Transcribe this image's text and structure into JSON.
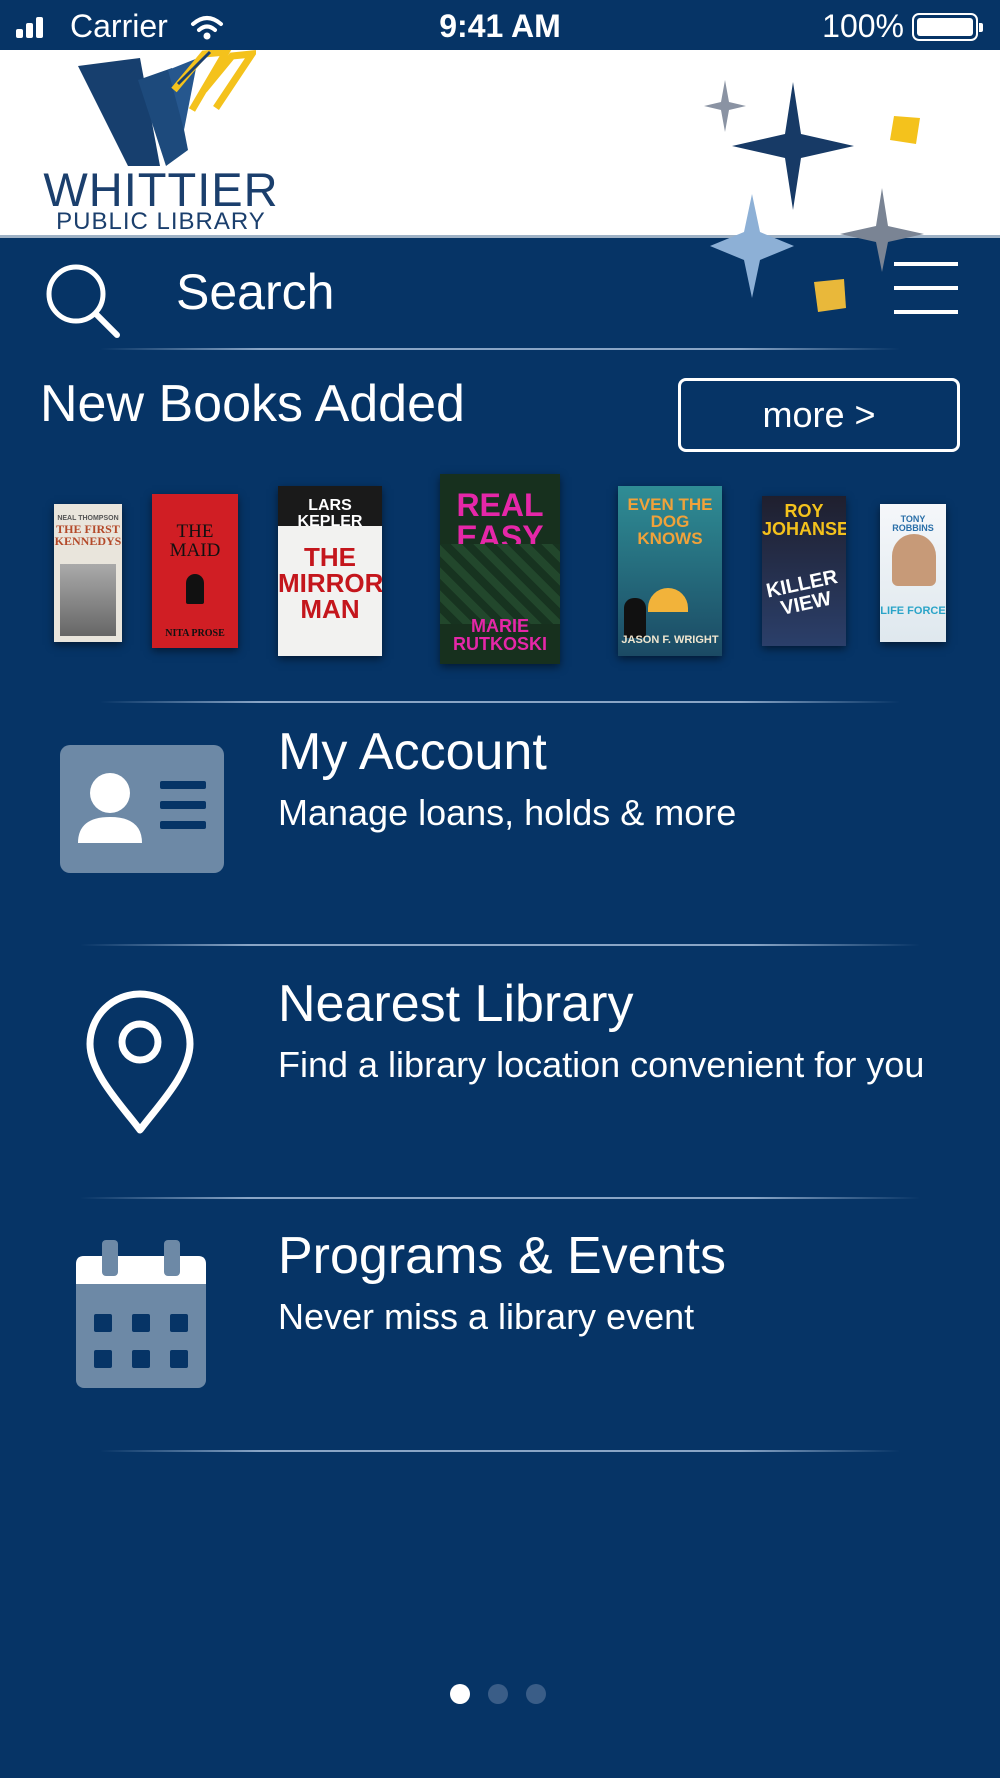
{
  "status_bar": {
    "carrier": "Carrier",
    "time": "9:41 AM",
    "battery": "100%"
  },
  "header": {
    "logo_title": "WHITTIER",
    "logo_subtitle": "PUBLIC LIBRARY"
  },
  "search": {
    "placeholder": "Search"
  },
  "new_books": {
    "title": "New Books Added",
    "more_label": "more >",
    "books": [
      {
        "top": "NEAL THOMPSON",
        "mid": "THE FIRST KENNEDYS",
        "bottom": ""
      },
      {
        "top": "",
        "mid": "THE MAID",
        "bottom": "NITA PROSE"
      },
      {
        "top": "LARS KEPLER",
        "mid": "THE MIRROR MAN",
        "bottom": ""
      },
      {
        "top": "REAL EASY",
        "mid": "",
        "bottom": "MARIE RUTKOSKI"
      },
      {
        "top": "EVEN THE DOG KNOWS",
        "mid": "",
        "bottom": "JASON F. WRIGHT"
      },
      {
        "top": "ROY JOHANSEN",
        "mid": "KILLER VIEW",
        "bottom": ""
      },
      {
        "top": "TONY ROBBINS",
        "mid": "",
        "bottom": "LIFE FORCE"
      }
    ]
  },
  "menu_items": [
    {
      "title": "My Account",
      "subtitle": "Manage loans, holds & more",
      "icon": "account-card-icon"
    },
    {
      "title": "Nearest Library",
      "subtitle": "Find a library location convenient for you",
      "icon": "map-pin-icon"
    },
    {
      "title": "Programs & Events",
      "subtitle": "Never miss a library event",
      "icon": "calendar-icon"
    }
  ],
  "pagination": {
    "pages": 3,
    "active": 1
  },
  "colors": {
    "background": "#063466",
    "header_bg": "#ffffff",
    "logo_navy": "#1b3f6d",
    "gold": "#f4c21c",
    "icon_slate": "#6d89a6"
  }
}
